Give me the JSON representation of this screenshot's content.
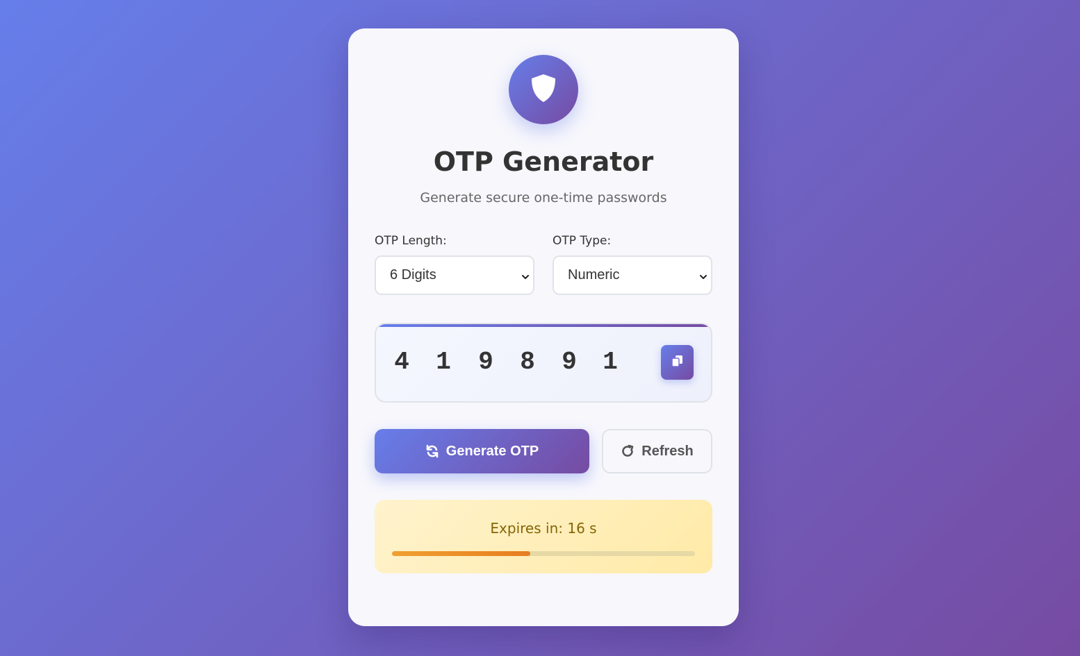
{
  "app": {
    "title": "OTP Generator",
    "subtitle": "Generate secure one-time passwords",
    "logo_icon": "shield-icon"
  },
  "settings": {
    "length_label": "OTP Length:",
    "length_value": "6 Digits",
    "type_label": "OTP Type:",
    "type_value": "Numeric"
  },
  "otp": {
    "digits": [
      "4",
      "1",
      "9",
      "8",
      "9",
      "1"
    ],
    "copy_icon": "copy-icon"
  },
  "actions": {
    "generate_label": "Generate OTP",
    "generate_icon": "sync-icon",
    "refresh_label": "Refresh",
    "refresh_icon": "redo-icon"
  },
  "expiry": {
    "text": "Expires in: 16 s",
    "progress_fraction": 0.457
  },
  "colors": {
    "accent_start": "#667eea",
    "accent_end": "#764ba2",
    "expiry_text": "#856404",
    "progress": "#e67e22"
  }
}
